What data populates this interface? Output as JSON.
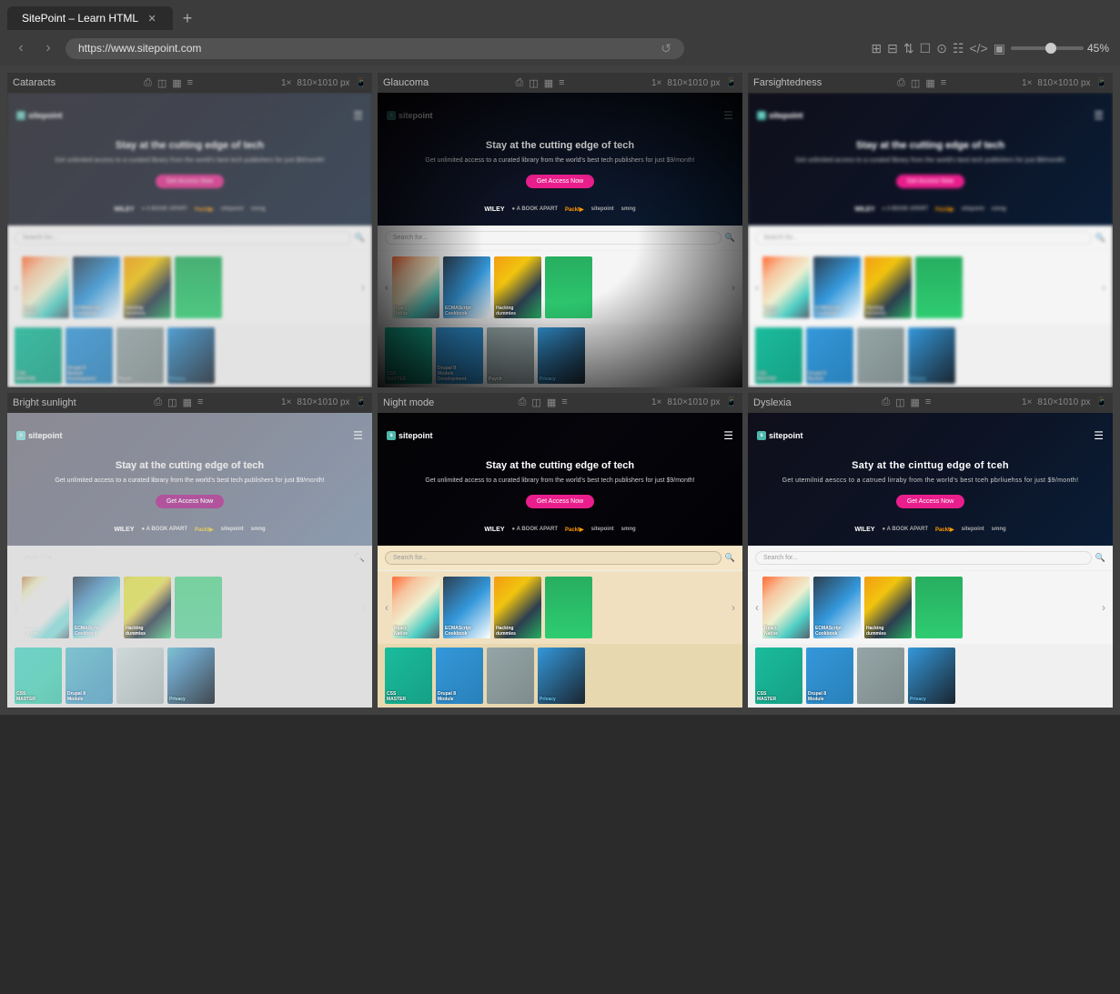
{
  "browser": {
    "tab_label": "SitePoint – Learn HTML",
    "new_tab_label": "+",
    "url": "https://www.sitepoint.com",
    "zoom_level": "45%"
  },
  "panels": [
    {
      "id": "cataracts",
      "label": "Cataracts",
      "scale": "1×",
      "dimensions": "810×1010 px",
      "accessibility": "cataracts"
    },
    {
      "id": "glaucoma",
      "label": "Glaucoma",
      "scale": "1×",
      "dimensions": "810×1010 px",
      "accessibility": "glaucoma"
    },
    {
      "id": "farsightedness",
      "label": "Farsightedness",
      "scale": "1×",
      "dimensions": "810×1010 px",
      "accessibility": "farsightedness"
    },
    {
      "id": "bright-sunlight",
      "label": "Bright sunlight",
      "scale": "1×",
      "dimensions": "810×1010 px",
      "accessibility": "bright-sunlight"
    },
    {
      "id": "night-mode",
      "label": "Night mode",
      "scale": "1×",
      "dimensions": "810×1010 px",
      "accessibility": "night-mode"
    },
    {
      "id": "dyslexia",
      "label": "Dyslexia",
      "scale": "1×",
      "dimensions": "810×1010 px",
      "accessibility": "dyslexia"
    }
  ],
  "sitepoint": {
    "logo": "sitepoint",
    "hero_title": "Stay at the cutting edge of tech",
    "hero_subtitle": "Get unlimited access to a curated library from the world's best tech publishers for just $9/month!",
    "cta_label": "Get Access Now",
    "search_placeholder": "Search for...",
    "partners": [
      "WILEY",
      "A BOOK APART",
      "Packt",
      "sitepoint",
      "smiing"
    ],
    "books": [
      {
        "title": "React Native",
        "type": "react-native"
      },
      {
        "title": "ECMAScript Cookbook",
        "type": "ecma"
      },
      {
        "title": "Hacking dummies",
        "type": "hacking"
      },
      {
        "title": "",
        "type": "green"
      },
      {
        "title": "CSS MASTER",
        "type": "css"
      },
      {
        "title": "Drupal 8 Module Development",
        "type": "drupal"
      },
      {
        "title": "Psychology",
        "type": "psych"
      },
      {
        "title": "Privacy",
        "type": "privacy"
      }
    ]
  },
  "dyslexia": {
    "hero_title": "Saty at the cinttug edge of tceh",
    "hero_subtitle": "Get utemilnid aesccs to a catrued lirraby from the world's best tceh pbrliuehss for just $9/month!"
  }
}
